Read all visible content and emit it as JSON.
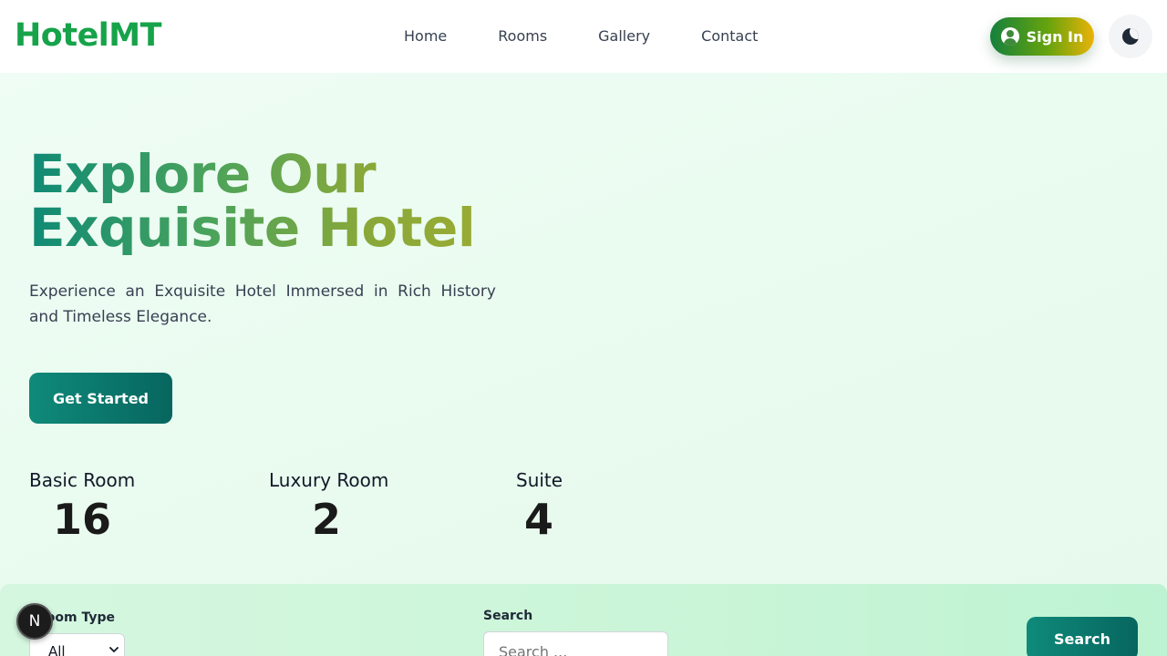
{
  "header": {
    "logo": "HotelMT",
    "nav": [
      "Home",
      "Rooms",
      "Gallery",
      "Contact"
    ],
    "sign_in_label": "Sign In",
    "sign_in_icon": "user-circle-icon",
    "theme_icon": "moon-icon"
  },
  "hero": {
    "headline_line1": "Explore Our",
    "headline_line2": "Exquisite Hotel",
    "subtitle": "Experience an Exquisite Hotel Immersed in Rich History and Timeless Elegance.",
    "cta_label": "Get Started",
    "stats": [
      {
        "label": "Basic Room",
        "value": "16"
      },
      {
        "label": "Luxury Room",
        "value": "2"
      },
      {
        "label": "Suite",
        "value": "4"
      }
    ]
  },
  "filter": {
    "room_type_label": "Room Type",
    "room_type_value": "All",
    "search_label": "Search",
    "search_placeholder": "Search ...",
    "search_button": "Search"
  },
  "badge": {
    "letter": "N"
  },
  "colors": {
    "brand": "#16a34a",
    "primary_button": "#0f8a7a",
    "hero_background": "#effdf5",
    "filter_background": "#ccf5d9"
  }
}
